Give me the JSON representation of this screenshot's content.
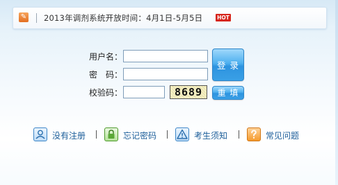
{
  "notice": {
    "text": "2013年调剂系统开放时间：4月1日-5月5日",
    "badge": "HOT",
    "icon": "notice-icon"
  },
  "login": {
    "username_label": "用户名：",
    "password_label": "密　码：",
    "captcha_label": "校验码：",
    "username_value": "",
    "password_value": "",
    "captcha_value": "",
    "captcha_image_text": "8689",
    "login_button": "登 录",
    "reset_button": "重 填"
  },
  "links": [
    {
      "label": "没有注册",
      "icon": "user-icon"
    },
    {
      "label": "忘记密码",
      "icon": "lock-icon"
    },
    {
      "label": "考生须知",
      "icon": "warning-icon"
    },
    {
      "label": "常见问题",
      "icon": "question-icon"
    }
  ],
  "colors": {
    "accent": "#2d93df",
    "hot": "#d6251b",
    "link": "#1d5e9a"
  }
}
